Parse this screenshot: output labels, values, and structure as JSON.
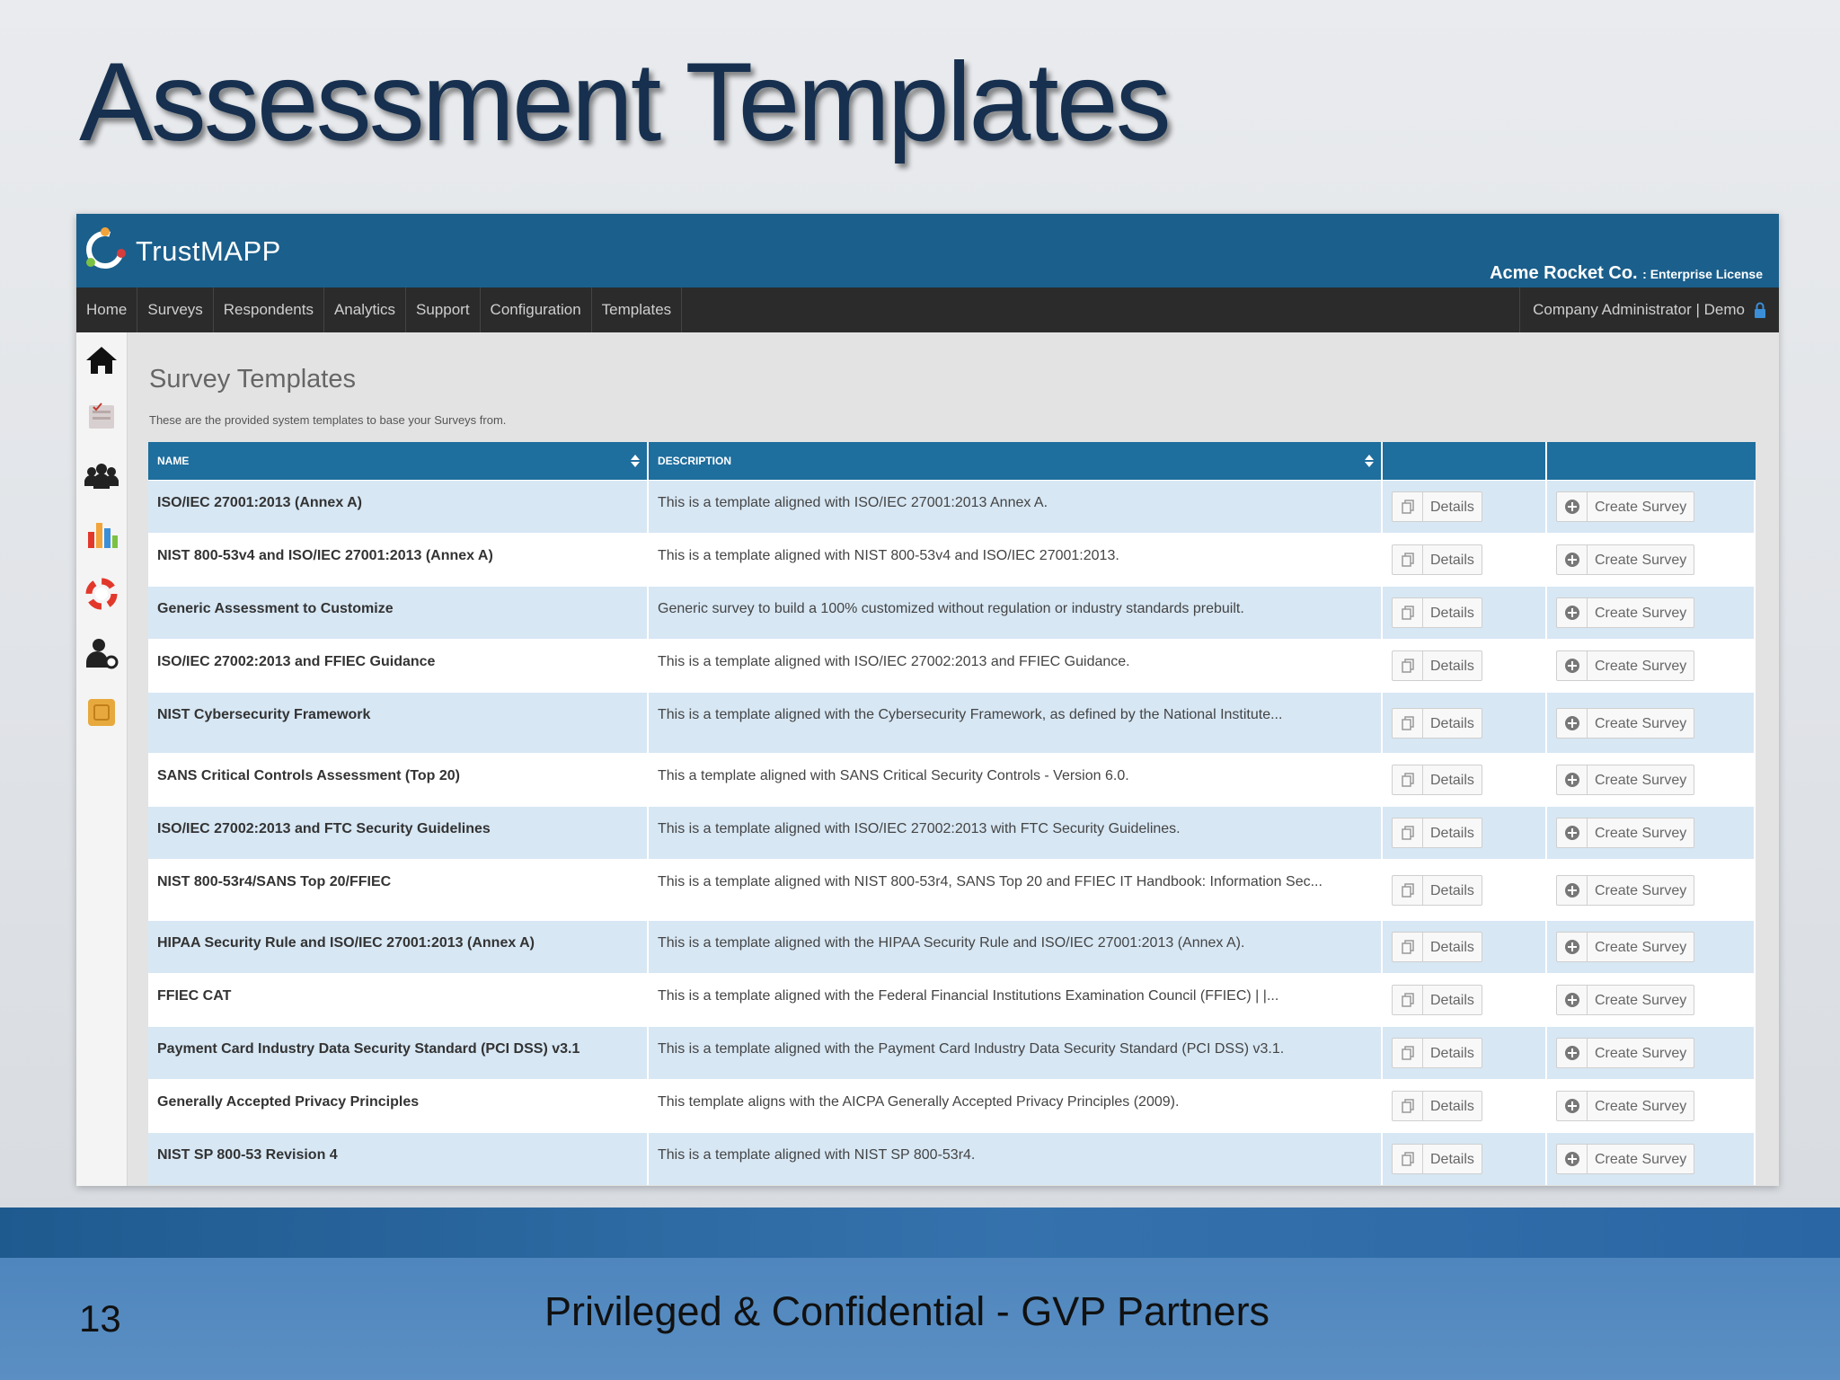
{
  "slide": {
    "title": "Assessment Templates",
    "page_number": "13",
    "footer": "Privileged & Confidential - GVP Partners"
  },
  "app": {
    "brand": "TrustMAPP",
    "org_name": "Acme Rocket Co.",
    "license": ": Enterprise License",
    "nav": [
      "Home",
      "Surveys",
      "Respondents",
      "Analytics",
      "Support",
      "Configuration",
      "Templates"
    ],
    "user_menu": "Company Administrator | Demo",
    "sidebar_icons": [
      "home-icon",
      "surveys-icon",
      "respondents-icon",
      "analytics-icon",
      "support-icon",
      "user-settings-icon",
      "templates-icon"
    ]
  },
  "page": {
    "title": "Survey Templates",
    "subtitle": "These are the provided system templates to base your Surveys from."
  },
  "table": {
    "headers": [
      "NAME",
      "DESCRIPTION",
      "",
      ""
    ],
    "details_label": "Details",
    "create_label": "Create Survey",
    "rows": [
      {
        "name": "ISO/IEC 27001:2013 (Annex A)",
        "description": "This is a template aligned with ISO/IEC 27001:2013 Annex A."
      },
      {
        "name": "NIST 800-53v4 and ISO/IEC 27001:2013 (Annex A)",
        "description": "This is a template aligned with NIST 800-53v4 and ISO/IEC 27001:2013."
      },
      {
        "name": "Generic Assessment to Customize",
        "description": "Generic survey to build a 100% customized without regulation or industry standards prebuilt."
      },
      {
        "name": "ISO/IEC 27002:2013 and FFIEC Guidance",
        "description": "This is a template aligned with ISO/IEC 27002:2013 and FFIEC Guidance."
      },
      {
        "name": "NIST Cybersecurity Framework",
        "description": "This is a template aligned with the Cybersecurity Framework, as defined by the National Institute..."
      },
      {
        "name": "SANS Critical Controls Assessment (Top 20)",
        "description": "This a template aligned with SANS Critical Security Controls - Version 6.0."
      },
      {
        "name": "ISO/IEC 27002:2013 and FTC Security Guidelines",
        "description": "This is a template aligned with ISO/IEC 27002:2013 with FTC Security Guidelines."
      },
      {
        "name": "NIST 800-53r4/SANS Top 20/FFIEC",
        "description": "This is a template aligned with NIST 800-53r4, SANS Top 20 and FFIEC IT Handbook: Information Sec..."
      },
      {
        "name": "HIPAA Security Rule and ISO/IEC 27001:2013 (Annex A)",
        "description": "This is a template aligned with the HIPAA Security Rule and ISO/IEC 27001:2013 (Annex A)."
      },
      {
        "name": "FFIEC CAT",
        "description": "This is a template aligned with the Federal Financial Institutions Examination Council (FFIEC) | |..."
      },
      {
        "name": "Payment Card Industry Data Security Standard (PCI DSS) v3.1",
        "description": "This is a template aligned with the Payment Card Industry Data Security Standard (PCI DSS) v3.1."
      },
      {
        "name": "Generally Accepted Privacy Principles",
        "description": "This template aligns with the AICPA Generally Accepted Privacy Principles (2009)."
      },
      {
        "name": "NIST SP 800-53 Revision 4",
        "description": "This is a template aligned with NIST SP 800-53r4."
      }
    ]
  },
  "colors": {
    "header_blue": "#1b5f8c",
    "nav_dark": "#2b2b2b",
    "table_header": "#1e6e9e",
    "row_alt": "#d7e7f4",
    "title_navy": "#17304f"
  }
}
